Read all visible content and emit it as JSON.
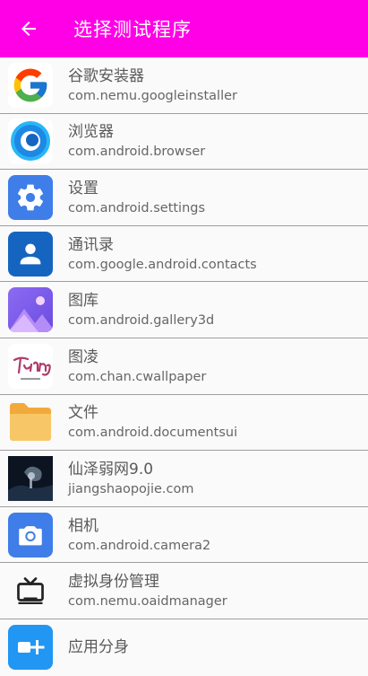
{
  "appbar": {
    "title": "选择测试程序",
    "color": "#ff00e6"
  },
  "apps": [
    {
      "name": "谷歌安装器",
      "package": "com.nemu.googleinstaller",
      "icon": "google-icon"
    },
    {
      "name": "浏览器",
      "package": "com.android.browser",
      "icon": "browser-icon"
    },
    {
      "name": "设置",
      "package": "com.android.settings",
      "icon": "settings-gear-icon"
    },
    {
      "name": "通讯录",
      "package": "com.google.android.contacts",
      "icon": "contacts-icon"
    },
    {
      "name": "图库",
      "package": "com.android.gallery3d",
      "icon": "gallery-icon"
    },
    {
      "name": "图凌",
      "package": "com.chan.cwallpaper",
      "icon": "turing-logo-icon"
    },
    {
      "name": "文件",
      "package": "com.android.documentsui",
      "icon": "folder-icon"
    },
    {
      "name": "仙泽弱网9.0",
      "package": "jiangshaopojie.com",
      "icon": "dark-photo-icon"
    },
    {
      "name": "相机",
      "package": "com.android.camera2",
      "icon": "camera-icon"
    },
    {
      "name": "虚拟身份管理",
      "package": "com.nemu.oaidmanager",
      "icon": "tv-icon"
    },
    {
      "name": "应用分身",
      "package": "",
      "icon": "app-clone-icon"
    }
  ]
}
